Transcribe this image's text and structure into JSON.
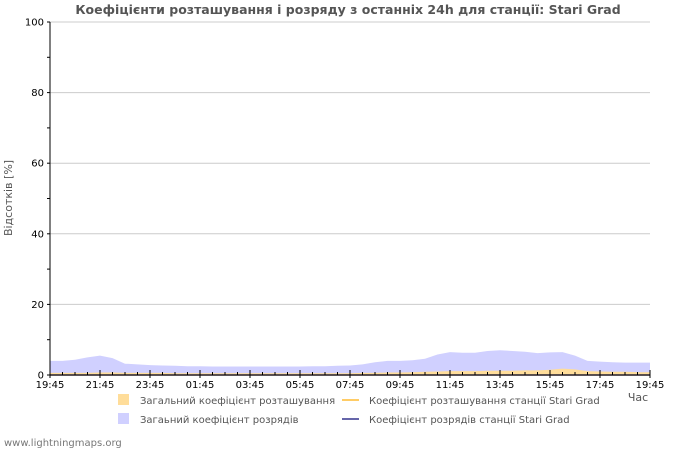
{
  "chart_data": {
    "type": "area",
    "title": "Коефіцієнти розташування і розряду з останніх 24h для станції: Stari Grad",
    "ylabel": "Відсотків   [%]",
    "xlabel": "Час",
    "ylim": [
      0,
      100
    ],
    "y_ticks": [
      "0",
      "20",
      "40",
      "60",
      "80",
      "100"
    ],
    "x_tick_labels": [
      "19:45",
      "21:45",
      "23:45",
      "01:45",
      "03:45",
      "05:45",
      "07:45",
      "09:45",
      "11:45",
      "13:45",
      "15:45",
      "17:45",
      "19:45"
    ],
    "x": [
      "19:45",
      "20:15",
      "20:45",
      "21:15",
      "21:45",
      "22:15",
      "22:45",
      "23:15",
      "23:45",
      "00:15",
      "00:45",
      "01:15",
      "01:45",
      "02:15",
      "02:45",
      "03:15",
      "03:45",
      "04:15",
      "04:45",
      "05:15",
      "05:45",
      "06:15",
      "06:45",
      "07:15",
      "07:45",
      "08:15",
      "08:45",
      "09:15",
      "09:45",
      "10:15",
      "10:45",
      "11:15",
      "11:45",
      "12:15",
      "12:45",
      "13:15",
      "13:45",
      "14:15",
      "14:45",
      "15:15",
      "15:45",
      "16:15",
      "16:45",
      "17:15",
      "17:45",
      "18:15",
      "18:45",
      "19:15",
      "19:45"
    ],
    "series": [
      {
        "name": "Загальний коефіцієнт розряду",
        "color": "#d0d0ff",
        "values": [
          4.0,
          4.0,
          4.3,
          5.0,
          5.5,
          4.8,
          3.2,
          3.0,
          2.8,
          2.7,
          2.6,
          2.5,
          2.5,
          2.4,
          2.4,
          2.4,
          2.4,
          2.4,
          2.4,
          2.4,
          2.4,
          2.5,
          2.5,
          2.6,
          2.7,
          3.0,
          3.6,
          4.0,
          4.0,
          4.2,
          4.6,
          5.8,
          6.5,
          6.3,
          6.3,
          6.8,
          7.0,
          6.8,
          6.6,
          6.2,
          6.4,
          6.5,
          5.5,
          4.0,
          3.8,
          3.6,
          3.5,
          3.5,
          3.5
        ]
      },
      {
        "name": "Загальний коефіцієнт розташування",
        "color": "#ffdd9a",
        "values": [
          0.6,
          0.6,
          0.6,
          0.6,
          0.7,
          0.7,
          0.6,
          0.6,
          0.6,
          0.6,
          0.5,
          0.5,
          0.5,
          0.5,
          0.5,
          0.5,
          0.5,
          0.5,
          0.5,
          0.5,
          0.5,
          0.5,
          0.5,
          0.5,
          0.5,
          0.6,
          0.6,
          0.7,
          0.7,
          0.8,
          0.9,
          1.0,
          1.1,
          1.1,
          1.1,
          1.2,
          1.2,
          1.2,
          1.3,
          1.3,
          1.5,
          1.8,
          1.6,
          1.1,
          1.0,
          0.9,
          0.9,
          0.8,
          0.8
        ]
      },
      {
        "name": "Коефіцієнт розташування станції Stari Grad",
        "color": "#ffcc66",
        "values": [
          0,
          0,
          0,
          0,
          0,
          0,
          0,
          0,
          0,
          0,
          0,
          0,
          0,
          0,
          0,
          0,
          0,
          0,
          0,
          0,
          0,
          0,
          0,
          0,
          0,
          0,
          0,
          0,
          0,
          0,
          0,
          0,
          0,
          0,
          0,
          0,
          0,
          0,
          0,
          0,
          0,
          0,
          0,
          0,
          0,
          0,
          0,
          0,
          0
        ]
      },
      {
        "name": "Коефіцієнт розрядів станції Stari Grad",
        "color": "#6666aa",
        "values": [
          0,
          0,
          0,
          0,
          0,
          0,
          0,
          0,
          0,
          0,
          0,
          0,
          0,
          0,
          0,
          0,
          0,
          0,
          0,
          0,
          0,
          0,
          0,
          0,
          0,
          0,
          0,
          0,
          0,
          0,
          0,
          0,
          0,
          0,
          0,
          0,
          0,
          0,
          0,
          0,
          0,
          0,
          0,
          0,
          0,
          0,
          0,
          0,
          0
        ]
      }
    ],
    "legend": [
      {
        "label": "Загальний коефіцієнт розташування",
        "kind": "box",
        "color": "#ffdd9a"
      },
      {
        "label": "Коефіцієнт розташування станції Stari Grad",
        "kind": "line",
        "color": "#ffcc66"
      },
      {
        "label": "Загаьний коефіцієнт розрядів",
        "kind": "box",
        "color": "#d0d0ff"
      },
      {
        "label": "Коефіцієнт розрядів станції Stari Grad",
        "kind": "line",
        "color": "#6666aa"
      }
    ],
    "legend_position": "bottom",
    "grid": "horizontal"
  },
  "footer": "www.lightningmaps.org"
}
